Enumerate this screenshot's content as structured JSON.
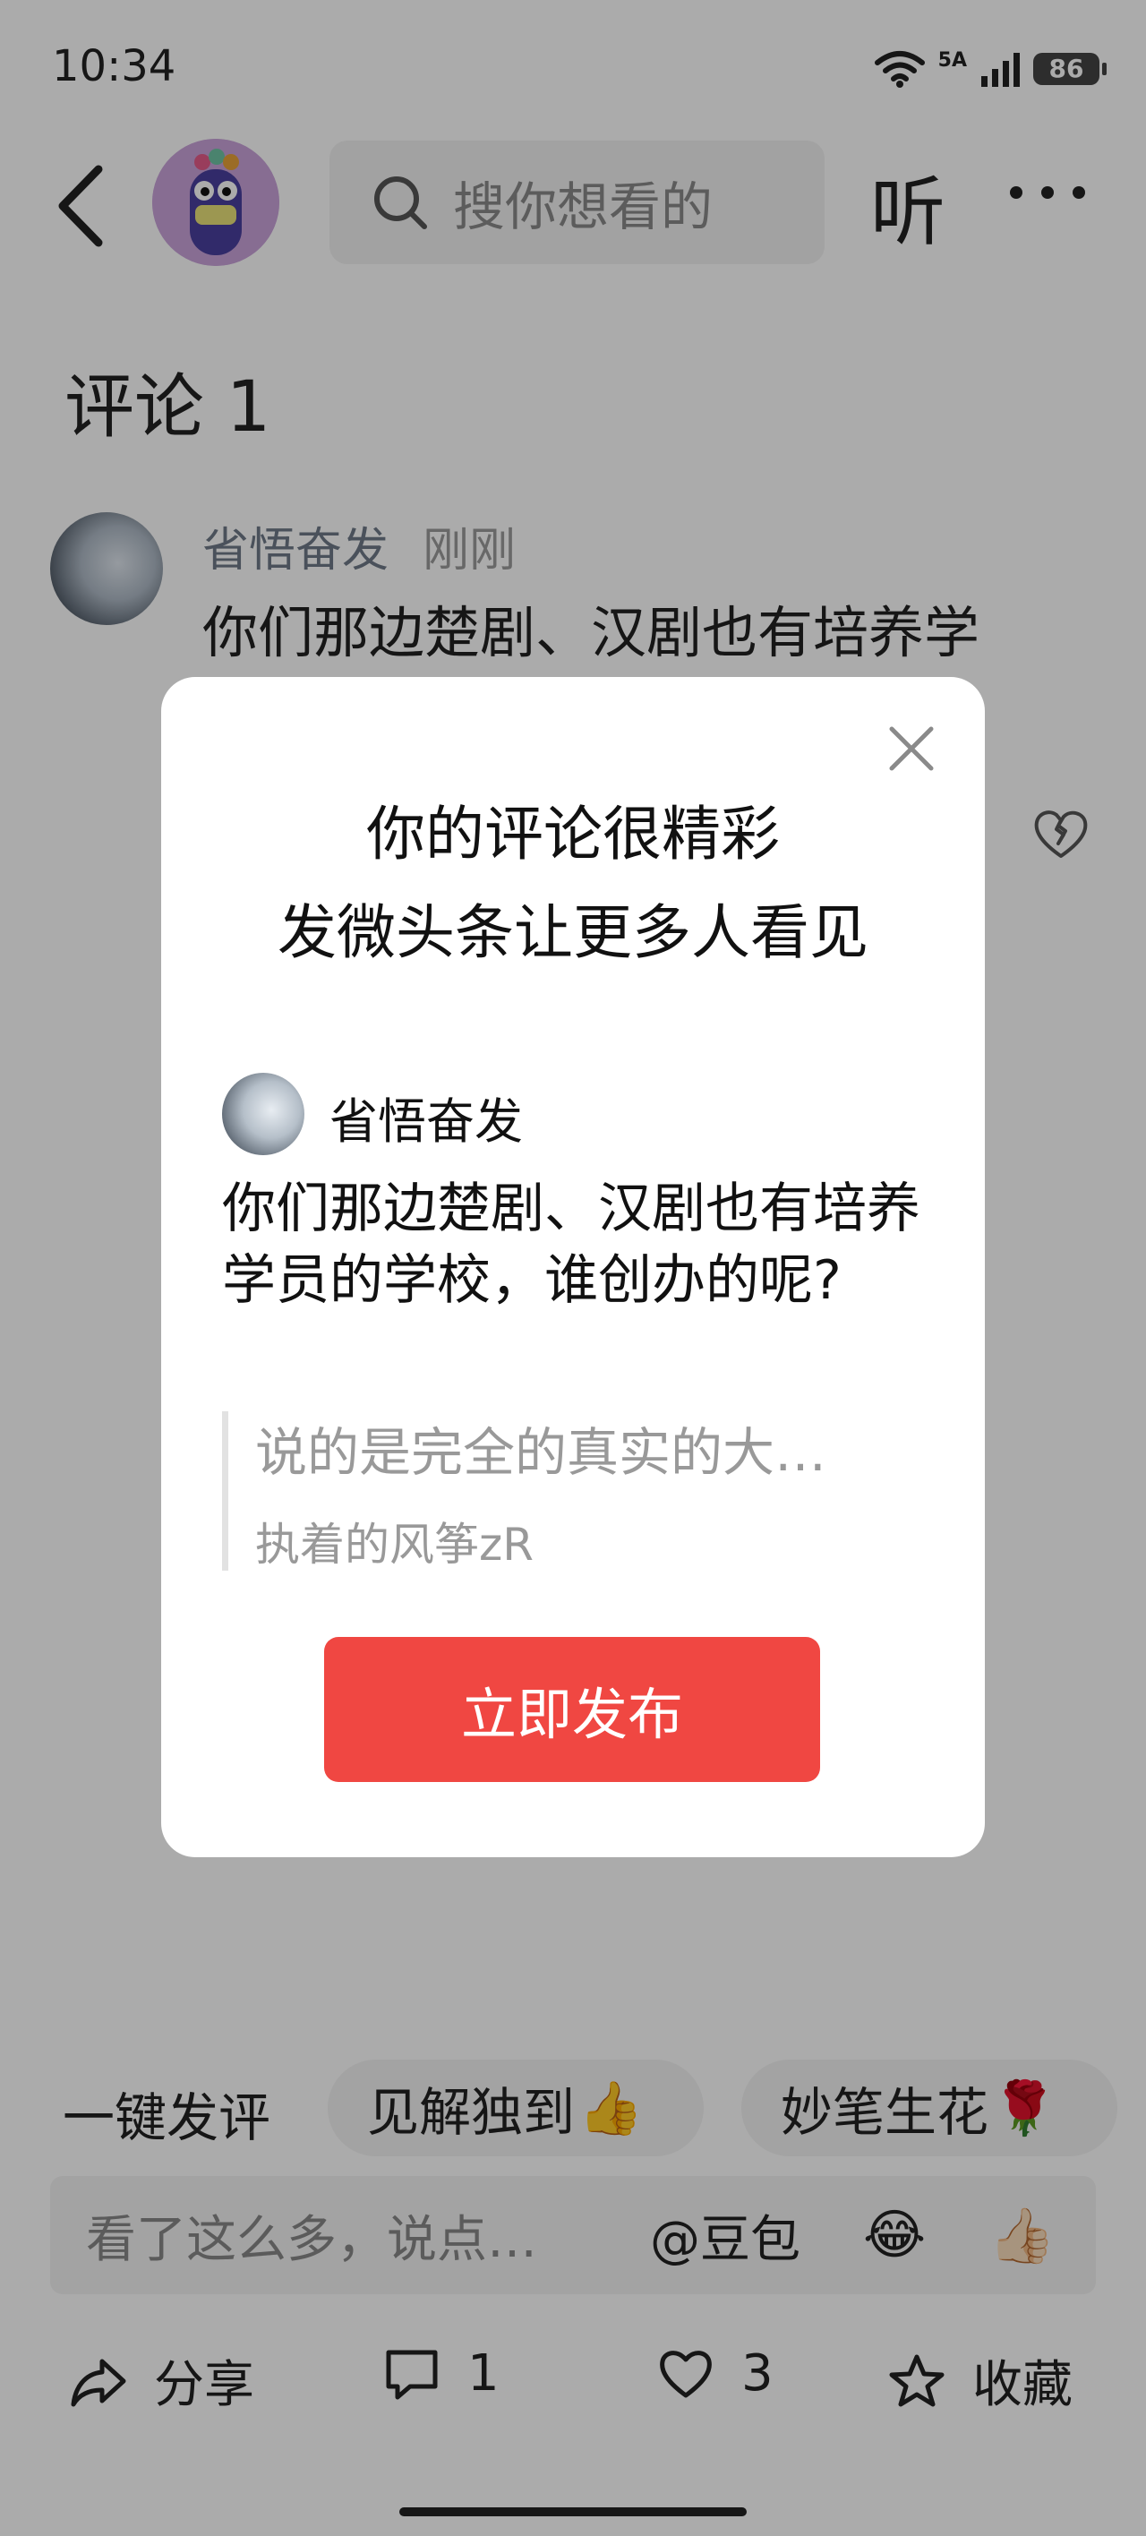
{
  "status_bar": {
    "time": "10:34",
    "network": "5A",
    "battery": "86"
  },
  "header": {
    "search_placeholder": "搜你想看的",
    "listen_label": "听"
  },
  "comments": {
    "title": "评论 1",
    "items": [
      {
        "user": "省悟奋发",
        "time": "刚刚",
        "text": "你们那边楚剧、汉剧也有培养学"
      }
    ]
  },
  "quick_reply": {
    "label": "一键发评",
    "chips": [
      {
        "text": "见解独到",
        "emoji": "👍"
      },
      {
        "text": "妙笔生花",
        "emoji": "🌹"
      }
    ]
  },
  "input": {
    "placeholder": "看了这么多，说点…",
    "mention": "@豆包",
    "emoji1": "😂",
    "emoji2": "👍🏻"
  },
  "bottom_bar": {
    "share_label": "分享",
    "comment_count": "1",
    "like_count": "3",
    "favorite_label": "收藏"
  },
  "modal": {
    "title_line1": "你的评论很精彩",
    "title_line2": "发微头条让更多人看见",
    "user": "省悟奋发",
    "text": "你们那边楚剧、汉剧也有培养学员的学校，谁创办的呢?",
    "quote_text": "说的是完全的真实的大…",
    "quote_author": "执着的风筝zR",
    "publish_button": "立即发布"
  },
  "colors": {
    "accent_red": "#f04742",
    "overlay": "rgba(0,0,0,0.33)"
  }
}
